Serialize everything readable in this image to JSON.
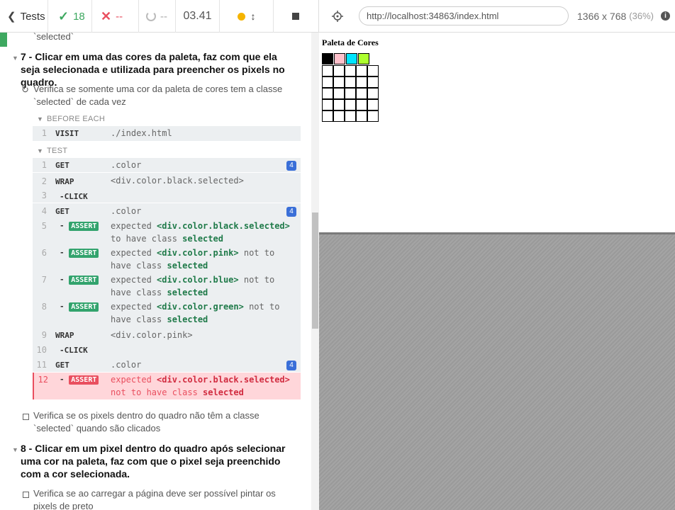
{
  "header": {
    "tests_label": "Tests",
    "passed": "18",
    "failed": "--",
    "pending": "--",
    "duration": "03.41",
    "url": "http://localhost:34863/index.html",
    "viewport_size": "1366 x 768",
    "viewport_pct": "(36%)",
    "info": "i"
  },
  "reporter": {
    "prev_tail": "`selected`",
    "suite7": {
      "title": "7 - Clicar em uma das cores da paleta, faz com que ela seja selecionada e utilizada para preencher os pixels no quadro.",
      "running_test": "Verifica se somente uma cor da paleta de cores tem a classe `selected` de cada vez",
      "before_each_label": "BEFORE EACH",
      "test_label": "TEST",
      "commands": [
        {
          "num": "1",
          "name": "VISIT",
          "msg": "./index.html"
        },
        {
          "num": "1",
          "name": "GET",
          "msg": ".color",
          "count": "4"
        },
        {
          "num": "2",
          "name": "WRAP",
          "msg": "<div.color.black.selected>"
        },
        {
          "num": "3",
          "name": "-CLICK",
          "msg": ""
        },
        {
          "num": "4",
          "name": "GET",
          "msg": ".color",
          "count": "4"
        },
        {
          "num": "5",
          "assert": "ASSERT",
          "pre": "expected ",
          "sel": "<div.color.black.selected>",
          "mid": " to have class ",
          "cls": "selected"
        },
        {
          "num": "6",
          "assert": "ASSERT",
          "pre": "expected ",
          "sel": "<div.color.pink>",
          "mid": " not to have class ",
          "cls": "selected"
        },
        {
          "num": "7",
          "assert": "ASSERT",
          "pre": "expected ",
          "sel": "<div.color.blue>",
          "mid": " not to have class ",
          "cls": "selected"
        },
        {
          "num": "8",
          "assert": "ASSERT",
          "pre": "expected ",
          "sel": "<div.color.green>",
          "mid": " not to have class ",
          "cls": "selected"
        },
        {
          "num": "9",
          "name": "WRAP",
          "msg": "<div.color.pink>"
        },
        {
          "num": "10",
          "name": "-CLICK",
          "msg": ""
        },
        {
          "num": "11",
          "name": "GET",
          "msg": ".color",
          "count": "4"
        },
        {
          "num": "12",
          "assert": "ASSERT",
          "pre": "expected ",
          "sel": "<div.color.black.selected>",
          "mid": " not to have class ",
          "cls": "selected"
        }
      ],
      "next_test": "Verifica se os pixels dentro do quadro não têm a classe `selected` quando são clicados"
    },
    "suite8": {
      "title": "8 - Clicar em um pixel dentro do quadro após selecionar uma cor na paleta, faz com que o pixel seja preenchido com a cor selecionada.",
      "first_test": "Verifica se ao carregar a página deve ser possível pintar os pixels de preto"
    }
  },
  "aut": {
    "title": "Paleta de Cores",
    "palette": [
      "#000000",
      "#ffc0cb",
      "#00e5ff",
      "#adff2f"
    ]
  }
}
